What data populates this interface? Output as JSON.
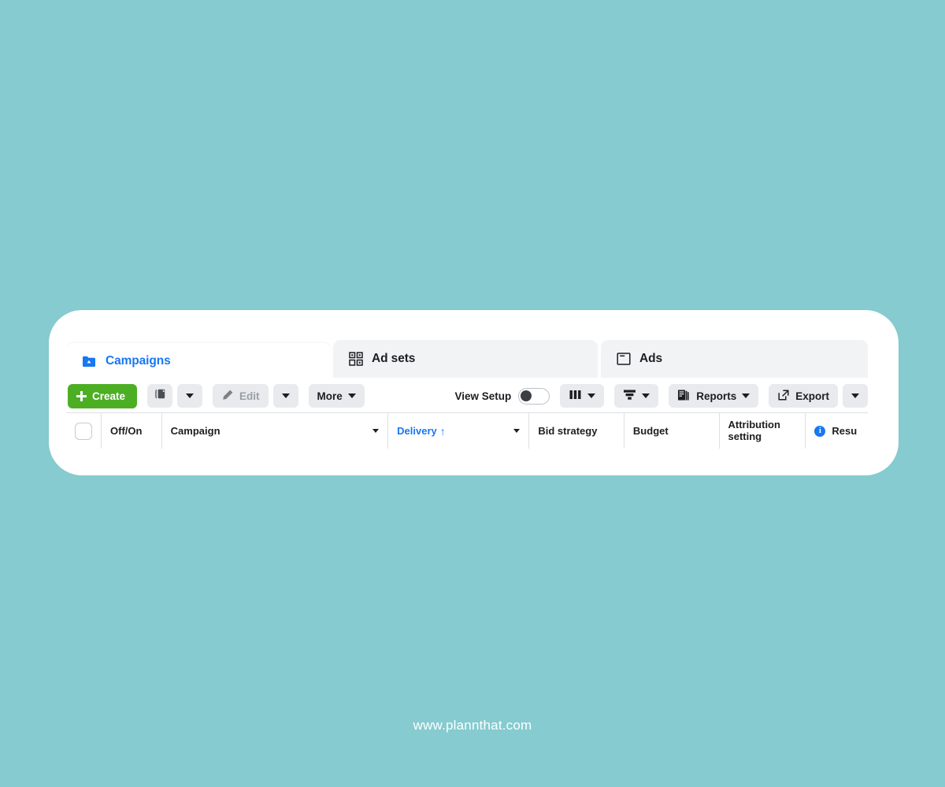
{
  "background_color": "#85cbd0",
  "accent_color": "#1877f2",
  "create_button_color": "#4caf23",
  "tabs": [
    {
      "label": "Campaigns",
      "icon": "folder-campaign-icon",
      "active": true
    },
    {
      "label": "Ad sets",
      "icon": "grid-adsets-icon",
      "active": false
    },
    {
      "label": "Ads",
      "icon": "window-ads-icon",
      "active": false
    }
  ],
  "toolbar": {
    "create_label": "Create",
    "duplicate_icon": "duplicate-icon",
    "edit_label": "Edit",
    "edit_icon": "pencil-icon",
    "more_label": "More",
    "view_setup_label": "View Setup",
    "view_setup_state": "off",
    "columns_icon": "columns-icon",
    "breakdown_icon": "breakdown-icon",
    "reports_label": "Reports",
    "reports_icon": "reports-icon",
    "export_label": "Export",
    "export_icon": "external-link-icon"
  },
  "table": {
    "columns": [
      {
        "label": "Off/On"
      },
      {
        "label": "Campaign"
      },
      {
        "label": "Delivery",
        "sort": "↑",
        "sorted": true
      },
      {
        "label": "Bid strategy"
      },
      {
        "label": "Budget"
      },
      {
        "label": "Attribution",
        "label2": "setting"
      },
      {
        "label": "Resu"
      }
    ]
  },
  "footer": {
    "url": "www.plannthat.com"
  }
}
